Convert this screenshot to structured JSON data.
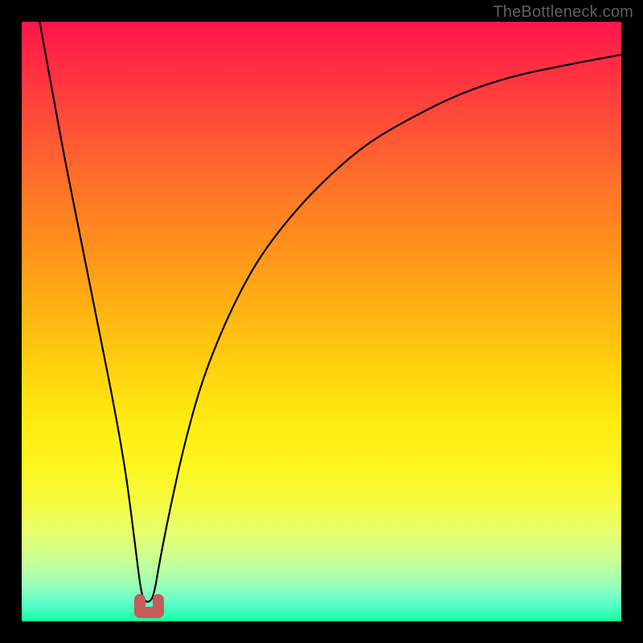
{
  "attribution": "TheBottleneck.com",
  "chart_data": {
    "type": "line",
    "title": "",
    "xlabel": "",
    "ylabel": "",
    "xlim": [
      0,
      100
    ],
    "ylim": [
      0,
      100
    ],
    "background_gradient_stops": [
      {
        "pct": 0,
        "color": "#ff1649"
      },
      {
        "pct": 8,
        "color": "#ff2f42"
      },
      {
        "pct": 18,
        "color": "#ff5236"
      },
      {
        "pct": 28,
        "color": "#ff7527"
      },
      {
        "pct": 38,
        "color": "#ff921b"
      },
      {
        "pct": 48,
        "color": "#ffb313"
      },
      {
        "pct": 58,
        "color": "#ffd20e"
      },
      {
        "pct": 66,
        "color": "#ffea10"
      },
      {
        "pct": 74,
        "color": "#fdf61e"
      },
      {
        "pct": 80,
        "color": "#f6fb3f"
      },
      {
        "pct": 85,
        "color": "#e8ff6d"
      },
      {
        "pct": 90,
        "color": "#c7ff97"
      },
      {
        "pct": 94,
        "color": "#9affb8"
      },
      {
        "pct": 97,
        "color": "#5affcb"
      },
      {
        "pct": 100,
        "color": "#15ff9e"
      }
    ],
    "series": [
      {
        "name": "bottleneck-curve",
        "color": "#000000",
        "stroke_width": 2,
        "x": [
          3,
          5,
          7,
          9,
          11,
          13,
          15,
          17,
          18,
          19,
          20,
          21,
          22,
          23,
          25,
          27,
          30,
          34,
          38,
          42,
          47,
          52,
          58,
          65,
          73,
          82,
          92,
          100
        ],
        "y": [
          100,
          89,
          78,
          68,
          58,
          48,
          38,
          27,
          20,
          12,
          4,
          3,
          4,
          10,
          20,
          29,
          40,
          50,
          58,
          64,
          70,
          75,
          80,
          84,
          88,
          91,
          93,
          94.5
        ]
      }
    ],
    "marker": {
      "name": "optimal-point",
      "color": "#c95a5a",
      "shape": "u",
      "x_range": [
        19,
        23
      ],
      "y_range": [
        0.5,
        4
      ]
    }
  }
}
